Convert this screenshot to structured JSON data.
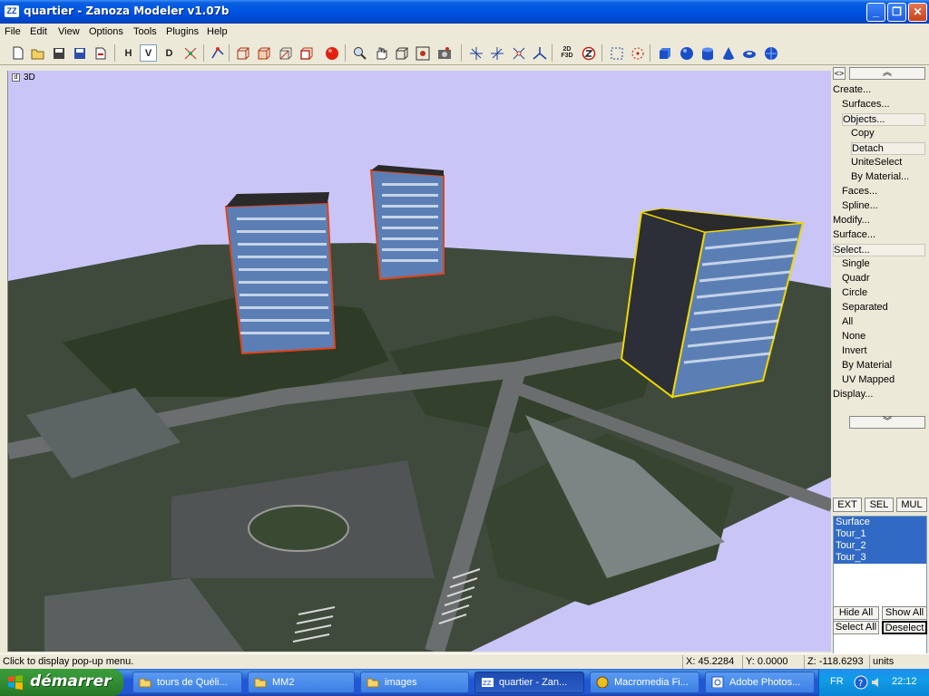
{
  "window": {
    "title": "quartier - Zanoza Modeler v1.07b",
    "minimize_glyph": "_",
    "restore_glyph": "❐",
    "close_glyph": "✕"
  },
  "menu": [
    "File",
    "Edit",
    "View",
    "Options",
    "Tools",
    "Plugins",
    "Help"
  ],
  "toolbar": {
    "letter_buttons": [
      "H",
      "V",
      "D"
    ],
    "pressed": "V",
    "twod_label": "2D F3D"
  },
  "viewport": {
    "label": "3D",
    "corner_icon": "d",
    "background": "#c9c6f7",
    "buildings": [
      "Tour_1",
      "Tour_2",
      "Tour_3"
    ]
  },
  "panel": {
    "collapse_glyph": "<>",
    "scroll_up_glyph": "︽",
    "scroll_down_glyph": "︾",
    "tree": [
      {
        "label": "Create...",
        "level": 0
      },
      {
        "label": "Surfaces...",
        "level": 1
      },
      {
        "label": "Objects...",
        "level": 1,
        "boxed": true
      },
      {
        "label": "Copy",
        "level": 2
      },
      {
        "label": "Detach",
        "level": 2,
        "boxed": true
      },
      {
        "label": "UniteSelect",
        "level": 2
      },
      {
        "label": "By Material...",
        "level": 2
      },
      {
        "label": "Faces...",
        "level": 1
      },
      {
        "label": "Spline...",
        "level": 1
      },
      {
        "label": "Modify...",
        "level": 0
      },
      {
        "label": "Surface...",
        "level": 0
      },
      {
        "label": "Select...",
        "level": 0,
        "boxed": true
      },
      {
        "label": "Single",
        "level": 1
      },
      {
        "label": "Quadr",
        "level": 1
      },
      {
        "label": "Circle",
        "level": 1
      },
      {
        "label": "Separated",
        "level": 1
      },
      {
        "label": "All",
        "level": 1
      },
      {
        "label": "None",
        "level": 1
      },
      {
        "label": "Invert",
        "level": 1
      },
      {
        "label": "By Material",
        "level": 1
      },
      {
        "label": "UV Mapped",
        "level": 1
      },
      {
        "label": "Display...",
        "level": 0
      }
    ],
    "mode_buttons": [
      "EXT",
      "SEL",
      "MUL"
    ],
    "objects": [
      "Surface",
      "Tour_1",
      "Tour_2",
      "Tour_3"
    ],
    "hide_all": "Hide All",
    "show_all": "Show All",
    "select_all": "Select All",
    "deselect": "Deselect"
  },
  "status": {
    "hint": "Click to display pop-up menu.",
    "x": "X: 45.2284",
    "y": "Y: 0.0000",
    "z": "Z: -118.6293",
    "units": "units"
  },
  "taskbar": {
    "start_label": "démarrer",
    "tasks": [
      {
        "label": "tours de Quéli...",
        "icon": "folder-icon"
      },
      {
        "label": "MM2",
        "icon": "folder-icon"
      },
      {
        "label": "images",
        "icon": "folder-icon"
      },
      {
        "label": "quartier - Zan...",
        "icon": "zanoza-icon",
        "active": true
      },
      {
        "label": "Macromedia Fi...",
        "icon": "macromedia-icon"
      },
      {
        "label": "Adobe Photos...",
        "icon": "photoshop-icon"
      }
    ],
    "lang": "FR",
    "clock": "22:12"
  },
  "colors": {
    "selection_blue": "#316ac5",
    "tower_outline_red": "#e0441c",
    "tower_outline_yellow": "#f0d800",
    "tower_facade_blue": "#5b7fb5"
  }
}
